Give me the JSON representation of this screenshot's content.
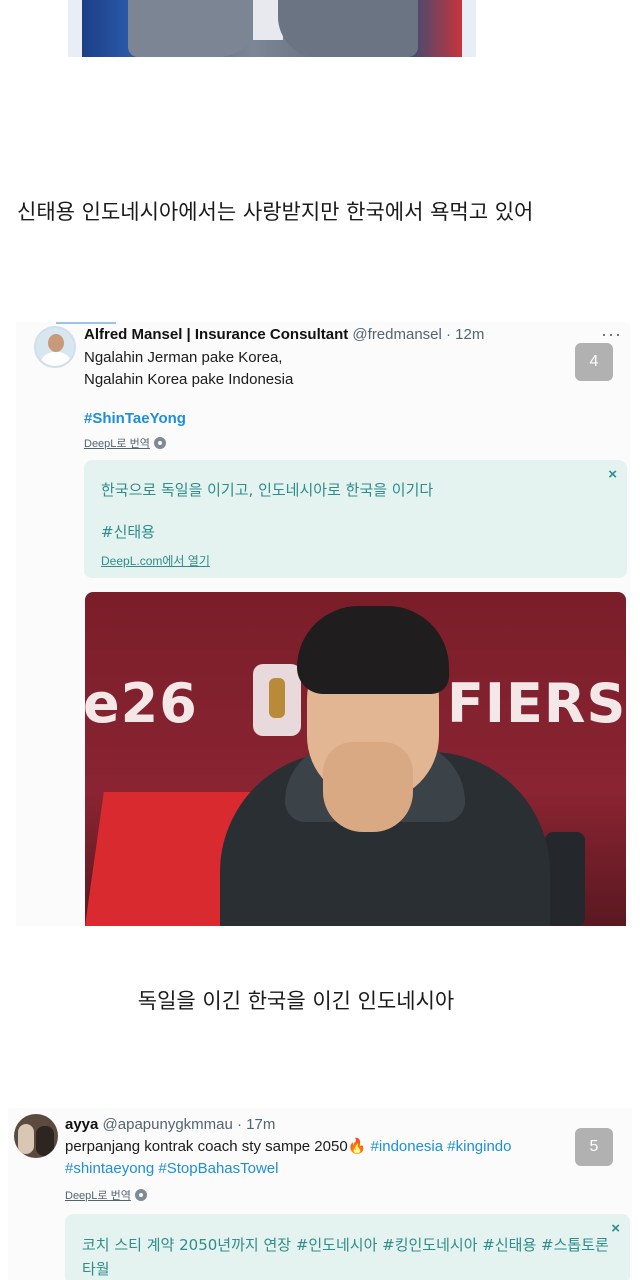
{
  "caption_top": "신태용 인도네시아에서는 사랑받지만 한국에서 욕먹고 있어",
  "caption_mid": "독일을 이긴 한국을 이긴 인도네시아",
  "tweet1": {
    "name": "Alfred Mansel | Insurance Consultant",
    "handle": "@fredmansel · 12m",
    "more": "···",
    "line1": "Ngalahin Jerman pake Korea,",
    "line2": "Ngalahin Korea pake Indonesia",
    "hashtag": "#ShinTaeYong",
    "deepl_label": "DeepL로 번역",
    "badge": "4",
    "translation": {
      "line1": "한국으로 독일을 이기고, 인도네시아로 한국을 이기다",
      "line2": "#신태용",
      "link": "DeepL.com에서 열기",
      "close": "×"
    },
    "photo": {
      "left_text": "e26",
      "right_text": "FIERS"
    }
  },
  "tweet2": {
    "name": "ayya",
    "handle": "@apapunygkmmau · 17m",
    "text_plain": "perpanjang kontrak coach sty sampe 2050",
    "emoji": "🔥",
    "tags_line1": "#indonesia #kingindo",
    "tags_line2": "#shintaeyong #StopBahasTowel",
    "deepl_label": "DeepL로 번역",
    "badge": "5",
    "translation": {
      "line1": "코치 스티 계약 2050년까지 연장 #인도네시아 #킹인도네시아 #신태용 #스톱토론타월",
      "close": "×"
    }
  },
  "colors": {
    "hashtag": "#1d8fd8",
    "translation_bg": "#e4f2f0",
    "translation_text": "#2e8d8a"
  },
  "icons": [
    "gear-icon",
    "close-icon",
    "more-icon"
  ]
}
